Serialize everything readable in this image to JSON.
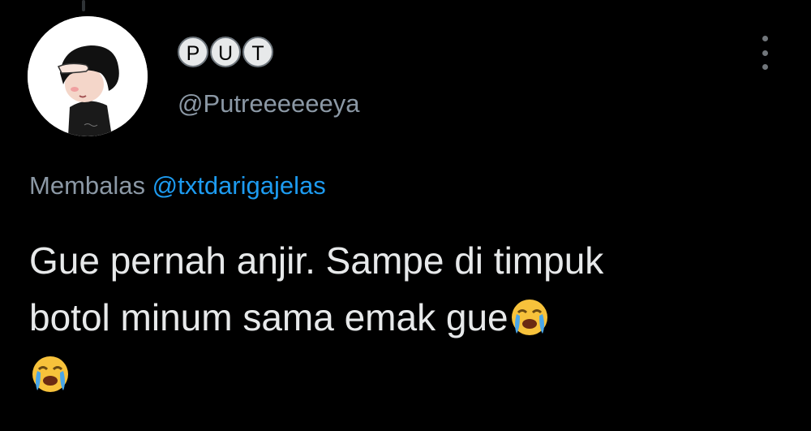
{
  "tweet": {
    "author": {
      "display_name_letters": [
        "P",
        "U",
        "T"
      ],
      "handle": "@Putreeeeeeya",
      "avatar": "avatar-cartoon-boy"
    },
    "reply_context": {
      "prefix": "Membalas",
      "mention": "@txtdarigajelas"
    },
    "text": {
      "line1": "Gue pernah anjir. Sampe di timpuk",
      "line2": "botol minum sama emak gue"
    },
    "emojis": [
      "loudly-crying-face",
      "loudly-crying-face"
    ],
    "menu_icon": "more-vertical-icon"
  },
  "colors": {
    "background": "#000000",
    "text_primary": "#e7e9ea",
    "text_secondary": "#8b98a5",
    "link": "#1d9bf0"
  }
}
